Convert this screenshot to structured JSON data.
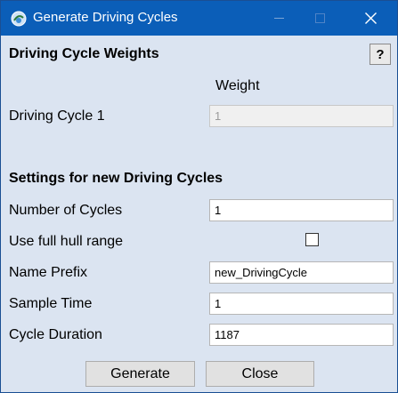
{
  "window": {
    "title": "Generate Driving Cycles",
    "icon": "driving-cycle-app-icon",
    "controls": {
      "minimize": "minimize-icon",
      "maximize": "maximize-icon",
      "close": "close-icon"
    }
  },
  "weights_section": {
    "title": "Driving Cycle Weights",
    "help_label": "?",
    "column_header": "Weight",
    "rows": [
      {
        "label": "Driving Cycle 1",
        "value": "1",
        "disabled": true
      }
    ]
  },
  "settings_section": {
    "title": "Settings for new Driving Cycles",
    "number_of_cycles": {
      "label": "Number of Cycles",
      "value": "1"
    },
    "use_full_hull_range": {
      "label": "Use full hull range",
      "checked": false
    },
    "name_prefix": {
      "label": "Name Prefix",
      "value": "new_DrivingCycle"
    },
    "sample_time": {
      "label": "Sample Time",
      "value": "1"
    },
    "cycle_duration": {
      "label": "Cycle Duration",
      "value": "1187"
    }
  },
  "buttons": {
    "generate": "Generate",
    "close": "Close"
  },
  "colors": {
    "titlebar": "#0b5eb8",
    "dialog_background": "#dbe4f1",
    "button_face": "#e1e1e1"
  }
}
